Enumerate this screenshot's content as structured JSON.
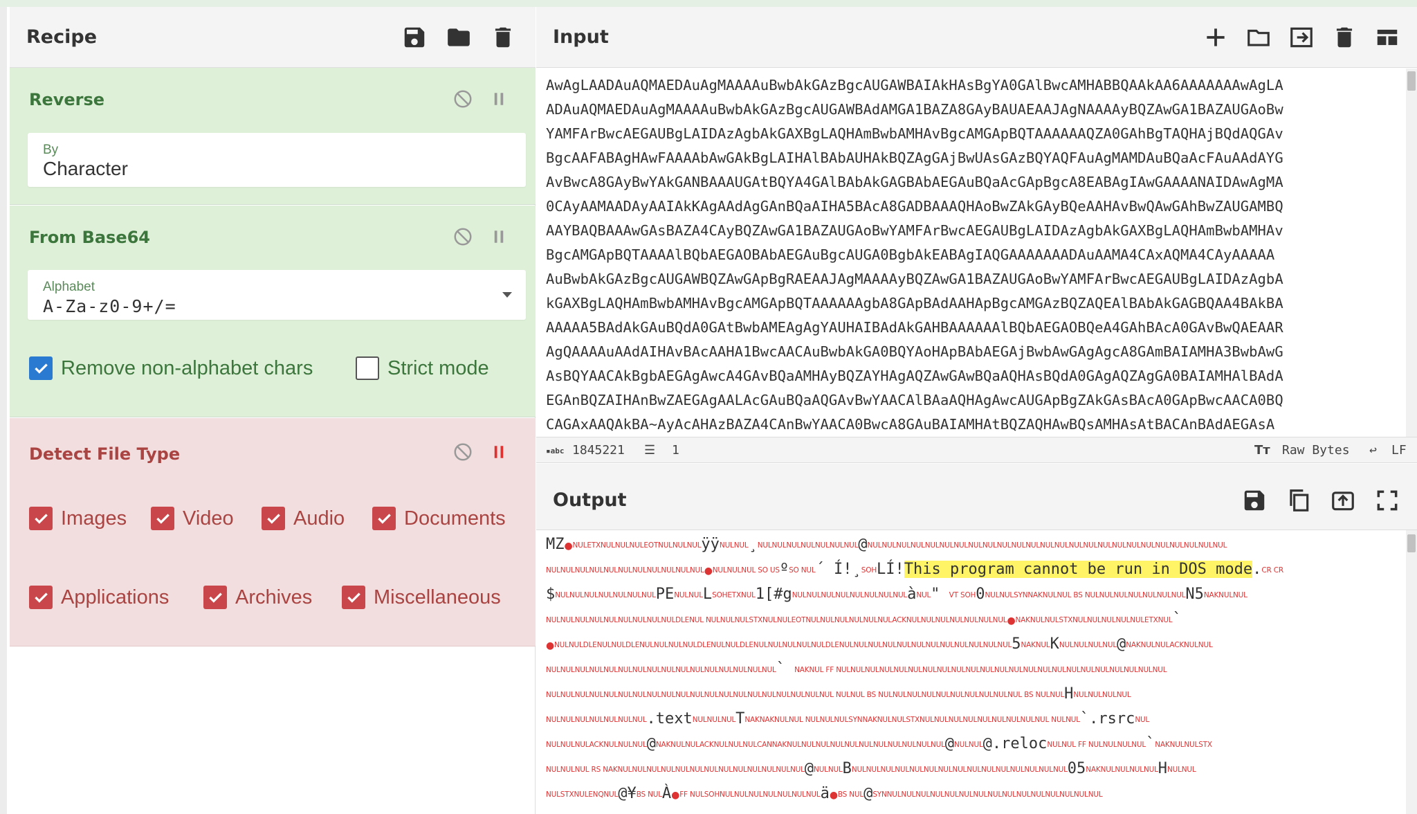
{
  "recipe": {
    "title": "Recipe",
    "icons": [
      "save-icon",
      "folder-icon",
      "trash-icon"
    ],
    "operations": [
      {
        "name": "Reverse",
        "state": "enabled",
        "fields": [
          {
            "label": "By",
            "value": "Character"
          }
        ]
      },
      {
        "name": "From Base64",
        "state": "enabled",
        "fields": [
          {
            "label": "Alphabet",
            "value": "A-Za-z0-9+/="
          }
        ],
        "checkboxes": [
          {
            "label": "Remove non-alphabet chars",
            "checked": true
          },
          {
            "label": "Strict mode",
            "checked": false
          }
        ]
      },
      {
        "name": "Detect File Type",
        "state": "breakpoint",
        "checkboxes": [
          {
            "label": "Images",
            "checked": true
          },
          {
            "label": "Video",
            "checked": true
          },
          {
            "label": "Audio",
            "checked": true
          },
          {
            "label": "Documents",
            "checked": true
          },
          {
            "label": "Applications",
            "checked": true
          },
          {
            "label": "Archives",
            "checked": true
          },
          {
            "label": "Miscellaneous",
            "checked": true
          }
        ]
      }
    ]
  },
  "input": {
    "title": "Input",
    "icons": [
      "plus-icon",
      "folder-icon",
      "import-icon",
      "trash-icon",
      "layout-icon"
    ],
    "lines": [
      "AwAgLAADAuAQMAEDAuAgMAAAAuBwbAkGAzBgcAUGAWBAIAkHAsBgYA0GAlBwcAMHABBQAAkAA6AAAAAAAwAgLA",
      "ADAuAQMAEDAuAgMAAAAuBwbAkGAzBgcAUGAWBAdAMGA1BAZA8GAyBAUAEAAJAgNAAAAyBQZAwGA1BAZAUGAoBw",
      "YAMFArBwcAEGAUBgLAIDAzAgbAkGAXBgLAQHAmBwbAMHAvBgcAMGApBQTAAAAAAQZA0GAhBgTAQHAjBQdAQGAv",
      "BgcAAFABAgHAwFAAAAbAwGAkBgLAIHAlBAbAUHAkBQZAgGAjBwUAsGAzBQYAQFAuAgMAMDAuBQaAcFAuAAdAYG",
      "AvBwcA8GAyBwYAkGANBAAAUGAtBQYA4GAlBAbAkGAGBAbAEGAuBQaAcGApBgcA8EABAgIAwGAAAANAIDAwAgMA",
      "0CAyAAMAADAyAAIAkKAgAAdAgGAnBQaAIHA5BAcA8GADBAAAQHAoBwZAkGAyBQeAAHAvBwQAwGAhBwZAUGAMBQ",
      "AAYBAQBAAAwGAsBAZA4CAyBQZAwGA1BAZAUGAoBwYAMFArBwcAEGAUBgLAIDAzAgbAkGAXBgLAQHAmBwbAMHAv",
      "BgcAMGApBQTAAAAlBQbAEGAOBAbAEGAuBgcAUGA0BgbAkEABAgIAQGAAAAAAADAuAAMA4CAxAQMA4CAyAAAAA",
      "AuBwbAkGAzBgcAUGAWBQZAwGApBgRAEAAJAgMAAAAyBQZAwGA1BAZAUGAoBwYAMFArBwcAEGAUBgLAIDAzAgbA",
      "kGAXBgLAQHAmBwbAMHAvBgcAMGApBQTAAAAAAgbA8GApBAdAAHApBgcAMGAzBQZAQEAlBAbAkGAGBQAA4BAkBA",
      "AAAAA5BAdAkGAuBQdA0GAtBwbAMEAgAgYAUHAIBAdAkGAHBAAAAAAlBQbAEGAOBQeA4GAhBAcA0GAvBwQAEAAR",
      "AgQAAAAuAAdAIHAvBAcAAHA1BwcAACAuBwbAkGA0BQYAoHApBAbAEGAjBwbAwGAgAgcA8GAmBAIAMHA3BwbAwG",
      "AsBQYAACAkBgbAEGAgAwcA4GAvBQaAMHAyBQZAYHAgAQZAwGAwBQaAQHAsBQdA0GAgAQZAgGA0BAIAMHAlBAdA",
      "EGAnBQZAIHAnBwZAEGAgAALAcGAuBQaAQGAvBwYAACAlBAaAQHAgAwcAUGApBgZAkGAsBAcA0GApBwcAACA0BQ",
      "CAGAxAAQAkBA~AyAcAHAzBAZA4CAnBwYAACA0BwcA8GAuBAIAMHAtBQZAQHAwBQsAMHAsAtBACAnBAdAEGAsA"
    ],
    "status": {
      "length": "1845221",
      "lines": "1",
      "encoding": "Raw Bytes",
      "eol": "LF"
    }
  },
  "output": {
    "title": "Output",
    "icons": [
      "save-icon",
      "copy-icon",
      "replace-input-icon",
      "maximize-icon"
    ],
    "highlight": "This program cannot be run in DOS mode"
  }
}
